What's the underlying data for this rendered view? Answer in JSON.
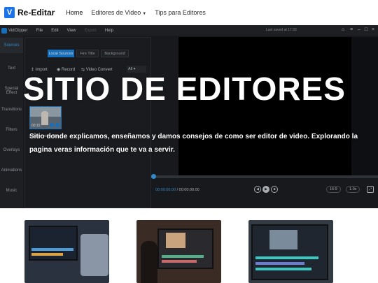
{
  "nav": {
    "logo_letter": "V",
    "logo_text": "Re-Editar",
    "links": [
      "Home",
      "Editores de Video",
      "Tips para Editores"
    ]
  },
  "app": {
    "name": "VidClipper",
    "menu": [
      "File",
      "Edit",
      "View",
      "Export",
      "Help"
    ],
    "last_saved": "Last saved at 17:33",
    "sidebar": [
      "Sources",
      "Text",
      "Special Effect",
      "Transitions",
      "Filters",
      "Overlays",
      "Animations",
      "Music"
    ],
    "library_tabs": [
      "Local Sources",
      "Fire Title",
      "Background"
    ],
    "tools": [
      "Import",
      "Record",
      "Video Convert"
    ],
    "filter_value": "All",
    "thumb_duration": "00:15",
    "thumb_label": "sample video 2....",
    "time_current": "00:00:00.00",
    "time_total": "/ 00:00:00.00",
    "ratio": "16:9",
    "speed": "1.0x"
  },
  "hero": {
    "title": "SITIO DE EDITORES",
    "description": "Sitio donde explicamos, enseñamos y damos consejos de como ser editor de video. Explorando la pagina veras información que te va a servir."
  },
  "colors": {
    "accent": "#1e88e5",
    "app_bg": "#1d1f23",
    "playhead": "#3fa9f5"
  }
}
